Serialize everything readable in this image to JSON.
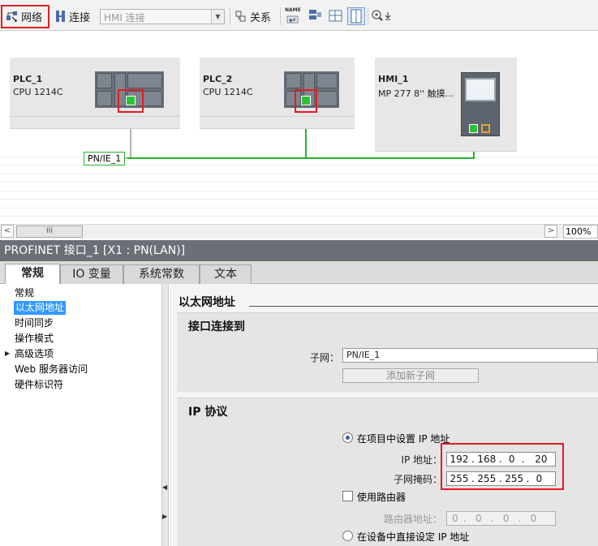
{
  "toolbar": {
    "network_label": "网络",
    "connection_label": "连接",
    "connection_type": "HMI 连接",
    "relation_label": "关系",
    "name_label": "NAME"
  },
  "devices": [
    {
      "name": "PLC_1",
      "type": "CPU 1214C"
    },
    {
      "name": "PLC_2",
      "type": "CPU 1214C"
    },
    {
      "name": "HMI_1",
      "type": "MP 277 8'' 触摸..."
    }
  ],
  "subnet_label": "PN/IE_1",
  "zoom": "100%",
  "scroll_grip": "III",
  "inspector": {
    "title": "PROFINET 接口_1 [X1 : PN(LAN)]",
    "tabs": [
      "常规",
      "IO 变量",
      "系统常数",
      "文本"
    ],
    "nav": [
      "常规",
      "以太网地址",
      "时间同步",
      "操作模式",
      "高级选项",
      "Web 服务器访问",
      "硬件标识符"
    ],
    "nav_expand_arrow": "▶",
    "section_title": "以太网地址",
    "group1_title": "接口连接到",
    "subnet_field_label": "子网：",
    "subnet_value": "PN/IE_1",
    "add_subnet_button": "添加新子网",
    "group2_title": "IP 协议",
    "radio_project_ip": "在项目中设置 IP 地址",
    "ip_label": "IP 地址：",
    "ip_octets": [
      "192",
      "168",
      "0",
      "20"
    ],
    "mask_label": "子网掩码：",
    "mask_octets": [
      "255",
      "255",
      "255",
      "0"
    ],
    "use_router_label": "使用路由器",
    "router_label": "路由器地址：",
    "router_octets": [
      "0",
      "0",
      "0",
      "0"
    ],
    "radio_device_ip": "在设备中直接设定 IP 地址"
  }
}
